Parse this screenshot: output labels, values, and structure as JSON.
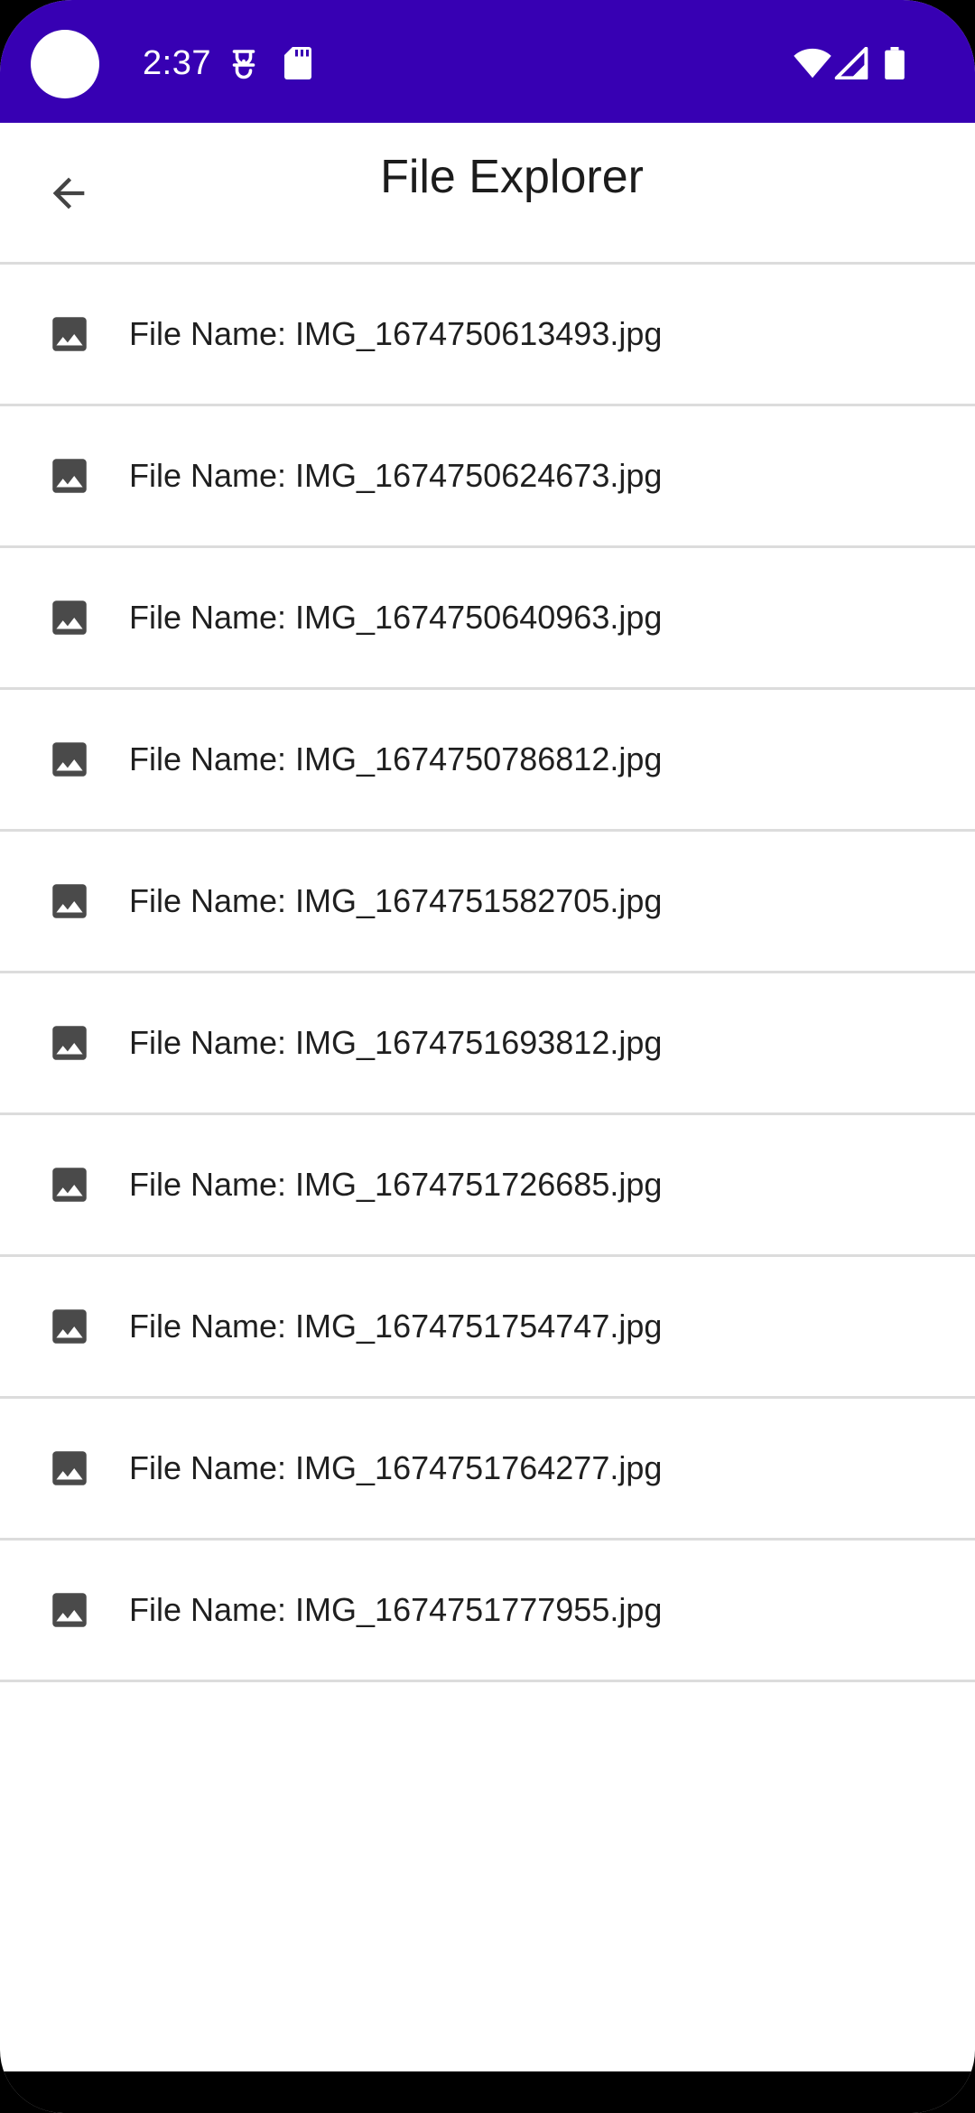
{
  "status_bar": {
    "time": "2:37",
    "background_color": "#3700b3",
    "icons": [
      "notification-icon",
      "sd-card-icon",
      "wifi-icon",
      "cell-signal-icon",
      "battery-icon"
    ]
  },
  "app_bar": {
    "title": "File Explorer",
    "back_icon": "arrow-back-icon"
  },
  "files": [
    {
      "label": "File Name: IMG_1674750613493.jpg",
      "icon": "image-icon"
    },
    {
      "label": "File Name: IMG_1674750624673.jpg",
      "icon": "image-icon"
    },
    {
      "label": "File Name: IMG_1674750640963.jpg",
      "icon": "image-icon"
    },
    {
      "label": "File Name: IMG_1674750786812.jpg",
      "icon": "image-icon"
    },
    {
      "label": "File Name: IMG_1674751582705.jpg",
      "icon": "image-icon"
    },
    {
      "label": "File Name: IMG_1674751693812.jpg",
      "icon": "image-icon"
    },
    {
      "label": "File Name: IMG_1674751726685.jpg",
      "icon": "image-icon"
    },
    {
      "label": "File Name: IMG_1674751754747.jpg",
      "icon": "image-icon"
    },
    {
      "label": "File Name: IMG_1674751764277.jpg",
      "icon": "image-icon"
    },
    {
      "label": "File Name: IMG_1674751777955.jpg",
      "icon": "image-icon"
    }
  ]
}
